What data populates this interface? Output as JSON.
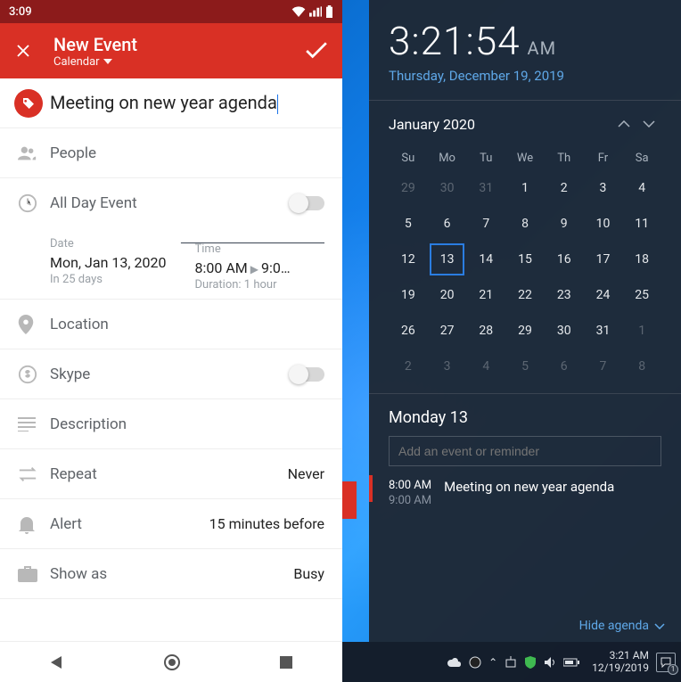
{
  "phone": {
    "status_time": "3:09",
    "appbar": {
      "title": "New Event",
      "subtitle": "Calendar"
    },
    "title_value": "Meeting on new year agenda",
    "people_label": "People",
    "allday_label": "All Day Event",
    "date": {
      "label": "Date",
      "value": "Mon, Jan 13, 2020",
      "sub": "In 25 days"
    },
    "time": {
      "label": "Time",
      "start": "8:00 AM",
      "end": "9:0…",
      "sub": "Duration: 1 hour"
    },
    "location_label": "Location",
    "skype_label": "Skype",
    "description_label": "Description",
    "repeat": {
      "label": "Repeat",
      "value": "Never"
    },
    "alert": {
      "label": "Alert",
      "value": "15 minutes before"
    },
    "showas": {
      "label": "Show as",
      "value": "Busy"
    }
  },
  "win": {
    "clock": {
      "time": "3:21:54",
      "ampm": "AM",
      "date": "Thursday, December 19, 2019"
    },
    "month_label": "January 2020",
    "dow": [
      "Su",
      "Mo",
      "Tu",
      "We",
      "Th",
      "Fr",
      "Sa"
    ],
    "weeks": [
      [
        {
          "d": "29",
          "dim": true
        },
        {
          "d": "30",
          "dim": true
        },
        {
          "d": "31",
          "dim": true
        },
        {
          "d": "1"
        },
        {
          "d": "2"
        },
        {
          "d": "3"
        },
        {
          "d": "4"
        }
      ],
      [
        {
          "d": "5"
        },
        {
          "d": "6"
        },
        {
          "d": "7"
        },
        {
          "d": "8"
        },
        {
          "d": "9"
        },
        {
          "d": "10"
        },
        {
          "d": "11"
        }
      ],
      [
        {
          "d": "12"
        },
        {
          "d": "13",
          "sel": true
        },
        {
          "d": "14"
        },
        {
          "d": "15"
        },
        {
          "d": "16"
        },
        {
          "d": "17"
        },
        {
          "d": "18"
        }
      ],
      [
        {
          "d": "19"
        },
        {
          "d": "20"
        },
        {
          "d": "21"
        },
        {
          "d": "22"
        },
        {
          "d": "23"
        },
        {
          "d": "24"
        },
        {
          "d": "25"
        }
      ],
      [
        {
          "d": "26"
        },
        {
          "d": "27"
        },
        {
          "d": "28"
        },
        {
          "d": "29"
        },
        {
          "d": "30"
        },
        {
          "d": "31"
        },
        {
          "d": "1",
          "dim": true
        }
      ],
      [
        {
          "d": "2",
          "dim": true
        },
        {
          "d": "3",
          "dim": true
        },
        {
          "d": "4",
          "dim": true
        },
        {
          "d": "5",
          "dim": true
        },
        {
          "d": "6",
          "dim": true
        },
        {
          "d": "7",
          "dim": true
        },
        {
          "d": "8",
          "dim": true
        }
      ]
    ],
    "agenda": {
      "title": "Monday 13",
      "placeholder": "Add an event or reminder",
      "event": {
        "start": "8:00 AM",
        "end": "9:00 AM",
        "title": "Meeting on new year agenda"
      }
    },
    "hide_label": "Hide agenda",
    "taskbar": {
      "time": "3:21 AM",
      "date": "12/19/2019",
      "notif_count": "1"
    }
  }
}
